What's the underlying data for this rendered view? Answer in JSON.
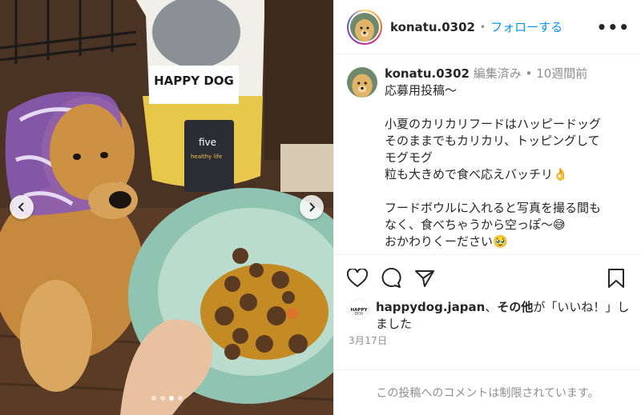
{
  "post": {
    "username": "konatu.0302",
    "follow_label": "フォローする",
    "separator": "•",
    "more_label": "•••",
    "edited_label": "編集済み",
    "time_ago": "10週間前",
    "caption_lines": [
      "応募用投稿〜",
      "",
      "小夏のカリカリフードはハッピードッグ",
      "そのままでもカリカリ、トッピングして",
      "モグモグ",
      "粒も大きめで食べ応えバッチリ👌",
      "",
      "フードボウルに入れると写真を撮る間も",
      "なく、食べちゃうから空っぽ〜😅",
      "おかわりくーださい🥹"
    ]
  },
  "media": {
    "bag_brand": "HAPPY DOG",
    "bag_label_line1": "five",
    "bag_label_line2": "healthy life",
    "carousel_count": 4,
    "carousel_active": 3
  },
  "likes": {
    "liker": "happydog.japan",
    "others": "その他",
    "mid_text": "、",
    "suffix": "が「いいね！」しました"
  },
  "date": "3月17日",
  "comments_disabled": "この投稿へのコメントは制限されています。",
  "icons": [
    "heart-icon",
    "comment-icon",
    "share-icon",
    "bookmark-icon",
    "chevron-left-icon",
    "chevron-right-icon"
  ],
  "colors": {
    "accent": "#0095f6",
    "muted": "#8e8e8e",
    "text": "#262626"
  }
}
